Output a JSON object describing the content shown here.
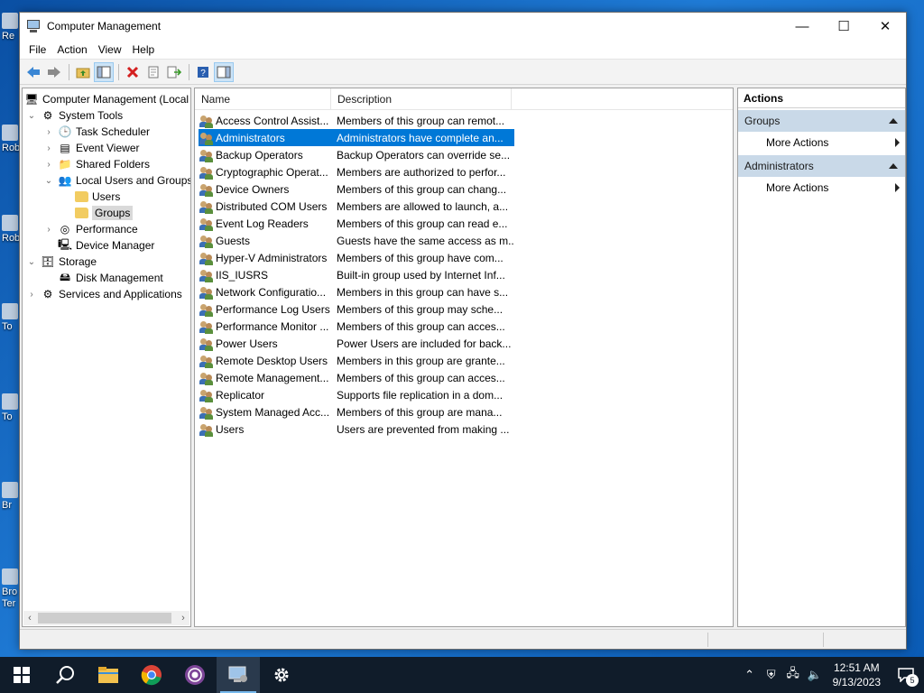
{
  "desktop": {
    "icons": [
      "Re",
      "Rob",
      "Rob",
      "To",
      "To",
      "Br",
      "Bro\nTer"
    ]
  },
  "window": {
    "title": "Computer Management",
    "controls": {
      "minimize": "—",
      "maximize": "☐",
      "close": "✕"
    }
  },
  "menubar": {
    "items": [
      "File",
      "Action",
      "View",
      "Help"
    ]
  },
  "toolbar": {
    "icons": [
      "back-icon",
      "forward-icon",
      "up-folder-icon",
      "show-hide-console-tree-icon",
      "delete-icon",
      "properties-icon",
      "export-list-icon",
      "help-icon",
      "show-hide-action-pane-icon"
    ]
  },
  "tree": {
    "nodes": [
      {
        "label": "Computer Management (Local",
        "level": 0,
        "expander": ""
      },
      {
        "label": "System Tools",
        "level": 1,
        "expander": "expanded"
      },
      {
        "label": "Task Scheduler",
        "level": 2,
        "expander": "collapsed"
      },
      {
        "label": "Event Viewer",
        "level": 2,
        "expander": "collapsed"
      },
      {
        "label": "Shared Folders",
        "level": 2,
        "expander": "collapsed"
      },
      {
        "label": "Local Users and Groups",
        "level": 2,
        "expander": "expanded"
      },
      {
        "label": "Users",
        "level": 3,
        "expander": ""
      },
      {
        "label": "Groups",
        "level": 3,
        "expander": "",
        "selected": true
      },
      {
        "label": "Performance",
        "level": 2,
        "expander": "collapsed"
      },
      {
        "label": "Device Manager",
        "level": 2,
        "expander": ""
      },
      {
        "label": "Storage",
        "level": 1,
        "expander": "expanded"
      },
      {
        "label": "Disk Management",
        "level": 2,
        "expander": ""
      },
      {
        "label": "Services and Applications",
        "level": 1,
        "expander": "collapsed"
      }
    ]
  },
  "list": {
    "columns": {
      "name": "Name",
      "description": "Description"
    },
    "rows": [
      {
        "name": "Access Control Assist...",
        "description": "Members of this group can remot..."
      },
      {
        "name": "Administrators",
        "description": "Administrators have complete an...",
        "selected": true
      },
      {
        "name": "Backup Operators",
        "description": "Backup Operators can override se..."
      },
      {
        "name": "Cryptographic Operat...",
        "description": "Members are authorized to perfor..."
      },
      {
        "name": "Device Owners",
        "description": "Members of this group can chang..."
      },
      {
        "name": "Distributed COM Users",
        "description": "Members are allowed to launch, a..."
      },
      {
        "name": "Event Log Readers",
        "description": "Members of this group can read e..."
      },
      {
        "name": "Guests",
        "description": "Guests have the same access as m..."
      },
      {
        "name": "Hyper-V Administrators",
        "description": "Members of this group have com..."
      },
      {
        "name": "IIS_IUSRS",
        "description": "Built-in group used by Internet Inf..."
      },
      {
        "name": "Network Configuratio...",
        "description": "Members in this group can have s..."
      },
      {
        "name": "Performance Log Users",
        "description": "Members of this group may sche..."
      },
      {
        "name": "Performance Monitor ...",
        "description": "Members of this group can acces..."
      },
      {
        "name": "Power Users",
        "description": "Power Users are included for back..."
      },
      {
        "name": "Remote Desktop Users",
        "description": "Members in this group are grante..."
      },
      {
        "name": "Remote Management...",
        "description": "Members of this group can acces..."
      },
      {
        "name": "Replicator",
        "description": "Supports file replication in a dom..."
      },
      {
        "name": "System Managed Acc...",
        "description": "Members of this group are mana..."
      },
      {
        "name": "Users",
        "description": "Users are prevented from making ..."
      }
    ]
  },
  "actions": {
    "header": "Actions",
    "sections": [
      {
        "title": "Groups",
        "items": [
          "More Actions"
        ]
      },
      {
        "title": "Administrators",
        "items": [
          "More Actions"
        ]
      }
    ]
  },
  "taskbar": {
    "apps": [
      "start-icon",
      "search-icon",
      "file-explorer-icon",
      "chrome-icon",
      "tor-browser-icon",
      "computer-management-icon",
      "settings-icon"
    ],
    "active_app": "computer-management-icon",
    "clock": {
      "time": "12:51 AM",
      "date": "9/13/2023"
    },
    "notifications_count": "5"
  },
  "colors": {
    "selection": "#0078d7",
    "action_section": "#c9d9e8",
    "taskbar": "#101c2a"
  }
}
